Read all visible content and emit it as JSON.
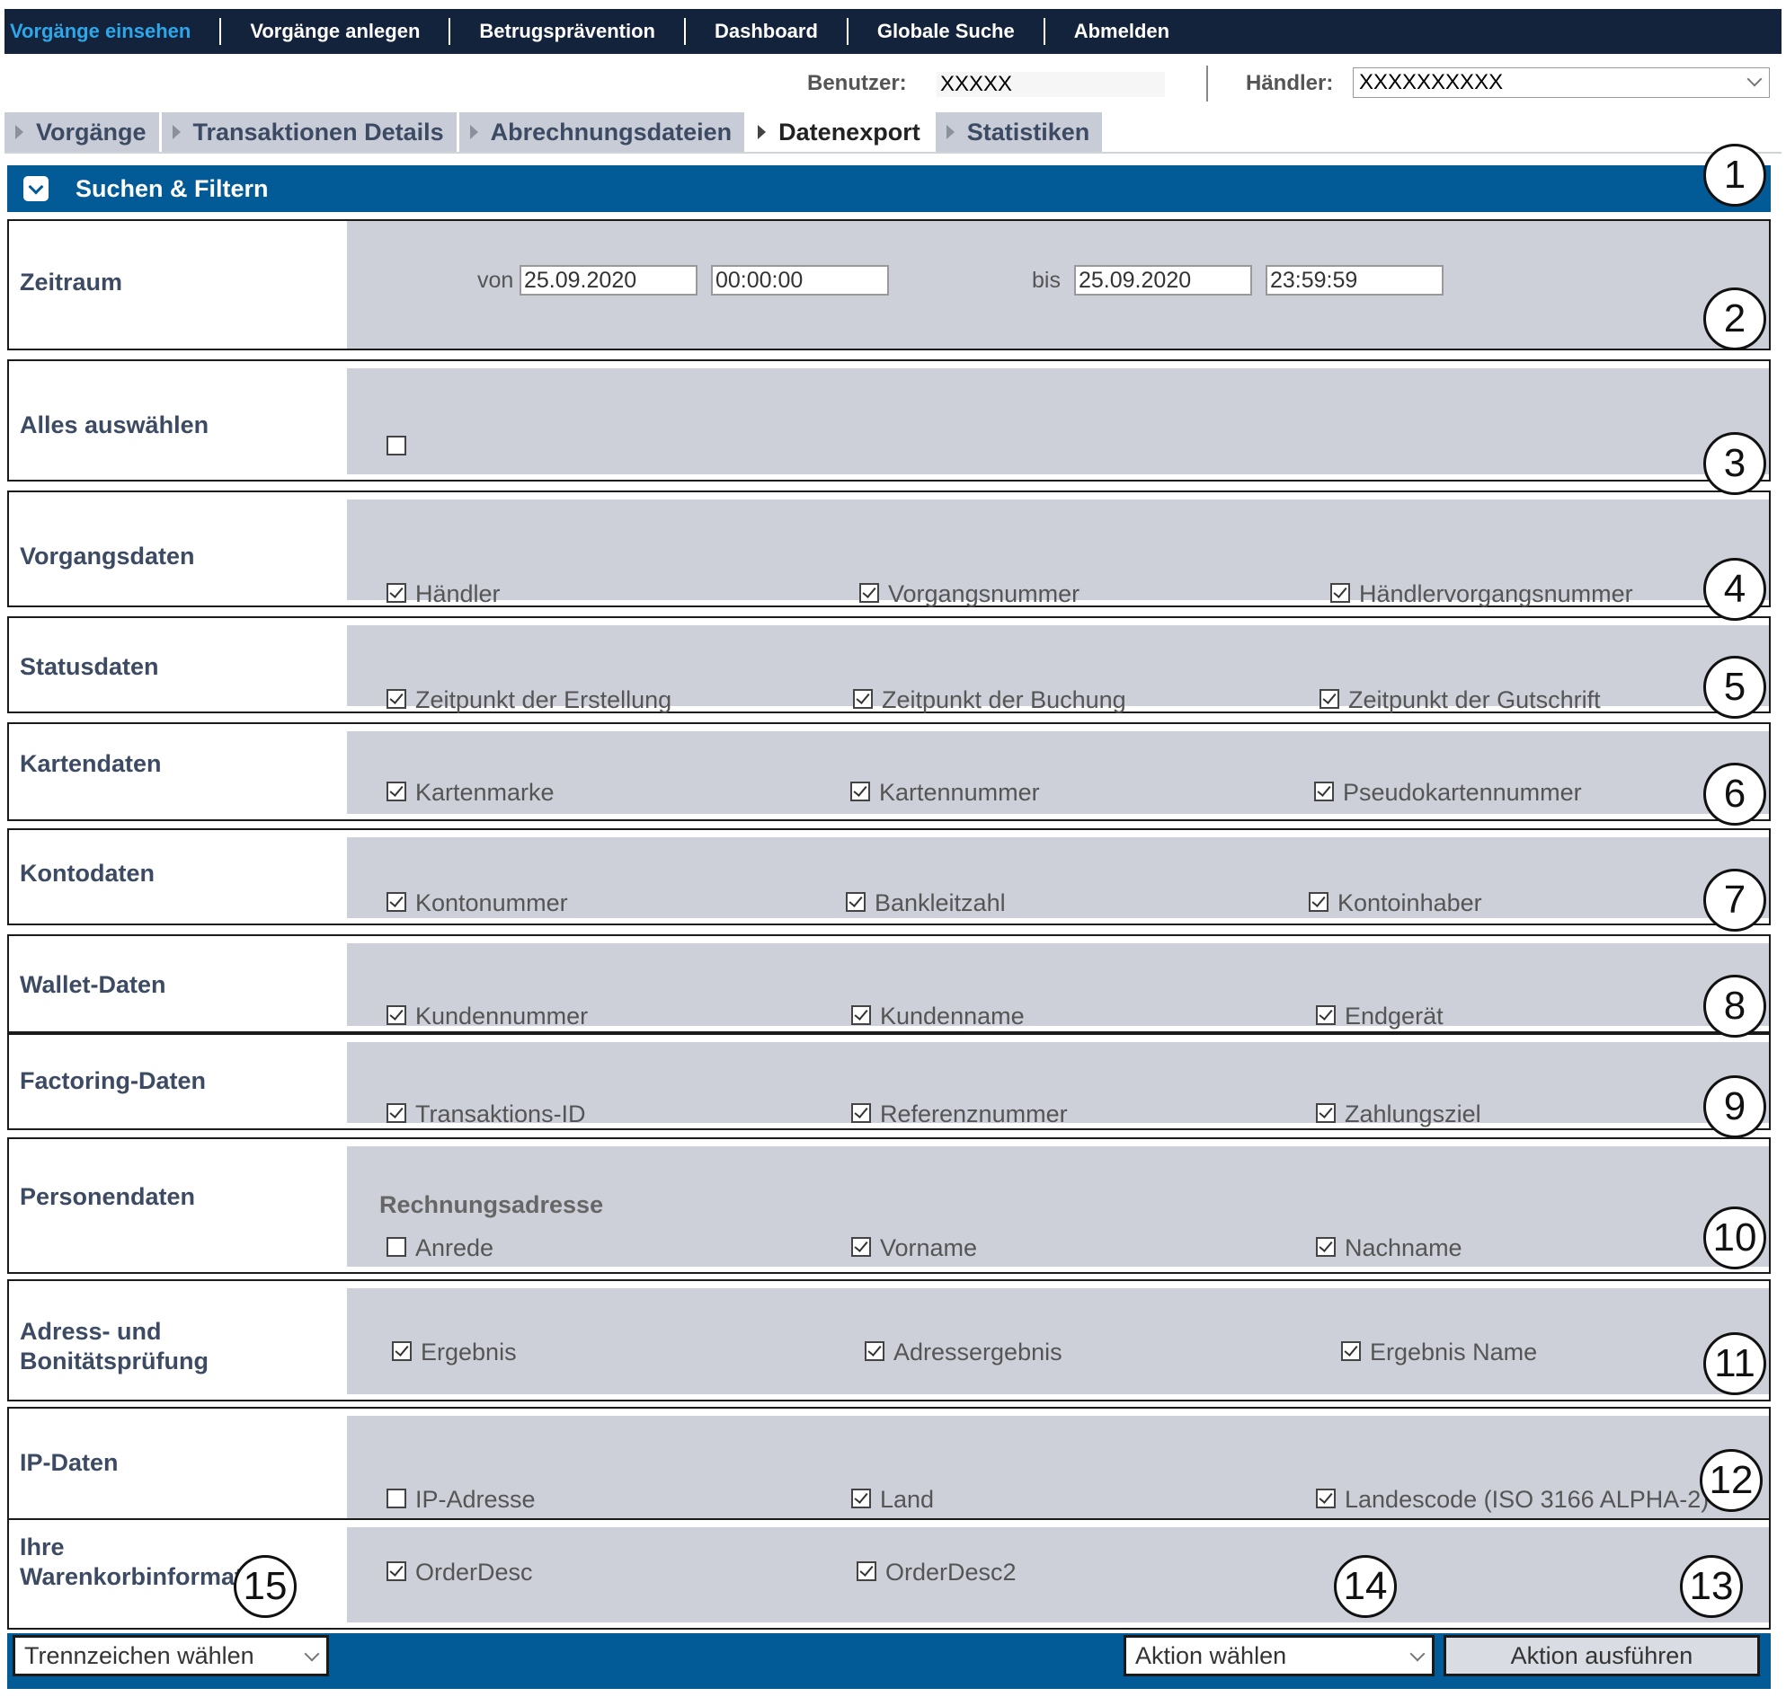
{
  "nav": [
    "Vorgänge einsehen",
    "Vorgänge anlegen",
    "Betrugsprävention",
    "Dashboard",
    "Globale Suche",
    "Abmelden"
  ],
  "userbar": {
    "user_label": "Benutzer:",
    "user_value": "XXXXX",
    "merchant_label": "Händler:",
    "merchant_value": "XXXXXXXXXX"
  },
  "tabs": [
    "Vorgänge",
    "Transaktionen Details",
    "Abrechnungsdateien",
    "Datenexport",
    "Statistiken"
  ],
  "active_tab": "Datenexport",
  "panel_title": "Suchen & Filtern",
  "zeitraum": {
    "label": "Zeitraum",
    "von": "von",
    "date_from": "25.09.2020",
    "time_from": "00:00:00",
    "bis": "bis",
    "date_to": "25.09.2020",
    "time_to": "23:59:59"
  },
  "select_all": {
    "label": "Alles auswählen",
    "checked": false
  },
  "rows": [
    {
      "label": "Vorgangsdaten",
      "items": [
        {
          "text": "Händler",
          "checked": true
        },
        {
          "text": "Vorgangsnummer",
          "checked": true
        },
        {
          "text": "Händlervorgangsnummer",
          "checked": true
        }
      ]
    },
    {
      "label": "Statusdaten",
      "items": [
        {
          "text": "Zeitpunkt der Erstellung",
          "checked": true
        },
        {
          "text": "Zeitpunkt der Buchung",
          "checked": true
        },
        {
          "text": "Zeitpunkt der Gutschrift",
          "checked": true
        }
      ]
    },
    {
      "label": "Kartendaten",
      "items": [
        {
          "text": "Kartenmarke",
          "checked": true
        },
        {
          "text": "Kartennummer",
          "checked": true
        },
        {
          "text": "Pseudokartennummer",
          "checked": true
        }
      ]
    },
    {
      "label": "Kontodaten",
      "items": [
        {
          "text": "Kontonummer",
          "checked": true
        },
        {
          "text": "Bankleitzahl",
          "checked": true
        },
        {
          "text": "Kontoinhaber",
          "checked": true
        }
      ]
    },
    {
      "label": "Wallet-Daten",
      "items": [
        {
          "text": "Kundennummer",
          "checked": true
        },
        {
          "text": "Kundenname",
          "checked": true
        },
        {
          "text": "Endgerät",
          "checked": true
        }
      ]
    },
    {
      "label": "Factoring-Daten",
      "items": [
        {
          "text": "Transaktions-ID",
          "checked": true
        },
        {
          "text": "Referenznummer",
          "checked": true
        },
        {
          "text": "Zahlungsziel",
          "checked": true
        }
      ]
    },
    {
      "label": "Personendaten",
      "sublabel": "Rechnungsadresse",
      "items": [
        {
          "text": "Anrede",
          "checked": false
        },
        {
          "text": "Vorname",
          "checked": true
        },
        {
          "text": "Nachname",
          "checked": true
        }
      ]
    },
    {
      "label": "Adress- und Bonitätsprüfung",
      "items": [
        {
          "text": "Ergebnis",
          "checked": true
        },
        {
          "text": "Adressergebnis",
          "checked": true
        },
        {
          "text": "Ergebnis Name",
          "checked": true
        }
      ]
    },
    {
      "label": "IP-Daten",
      "items": [
        {
          "text": "IP-Adresse",
          "checked": false
        },
        {
          "text": "Land",
          "checked": true
        },
        {
          "text": "Landescode (ISO 3166 ALPHA-2)",
          "checked": true
        }
      ]
    },
    {
      "label": "Ihre Warenkorbinformation",
      "items": [
        {
          "text": "OrderDesc",
          "checked": true
        },
        {
          "text": "OrderDesc2",
          "checked": true
        }
      ]
    }
  ],
  "footer": {
    "separator_select": "Trennzeichen wählen",
    "action_select": "Aktion wählen",
    "execute_button": "Aktion ausführen"
  },
  "callouts": [
    "1",
    "2",
    "3",
    "4",
    "5",
    "6",
    "7",
    "8",
    "9",
    "10",
    "11",
    "12",
    "13",
    "14",
    "15"
  ]
}
